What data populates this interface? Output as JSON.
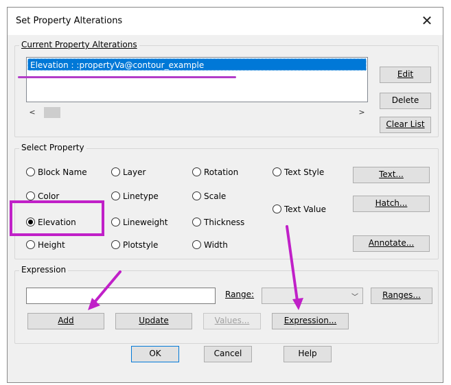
{
  "window": {
    "title": "Set Property Alterations"
  },
  "current_group": {
    "legend": "Current Property Alterations",
    "list_items": [
      "Elevation : :propertyVa@contour_example"
    ],
    "buttons": {
      "edit": "Edit",
      "delete": "Delete",
      "clear_list": "Clear List"
    }
  },
  "select_property": {
    "legend": "Select Property",
    "radios": {
      "block_name": "Block Name",
      "color": "Color",
      "elevation": "Elevation",
      "height": "Height",
      "layer": "Layer",
      "linetype": "Linetype",
      "lineweight": "Lineweight",
      "plotstyle": "Plotstyle",
      "rotation": "Rotation",
      "scale": "Scale",
      "thickness": "Thickness",
      "width": "Width",
      "text_style": "Text Style",
      "text_value": "Text Value"
    },
    "selected": "Elevation",
    "buttons": {
      "text": "Text...",
      "hatch": "Hatch...",
      "annotate": "Annotate..."
    }
  },
  "expression_group": {
    "legend": "Expression",
    "input_value": "",
    "range_label": "Range:",
    "range_value": "",
    "buttons": {
      "ranges": "Ranges...",
      "add": "Add",
      "update": "Update",
      "values": "Values...",
      "expression": "Expression..."
    }
  },
  "footer": {
    "ok": "OK",
    "cancel": "Cancel",
    "help": "Help"
  },
  "annotations": {
    "color": "#c020c8"
  }
}
